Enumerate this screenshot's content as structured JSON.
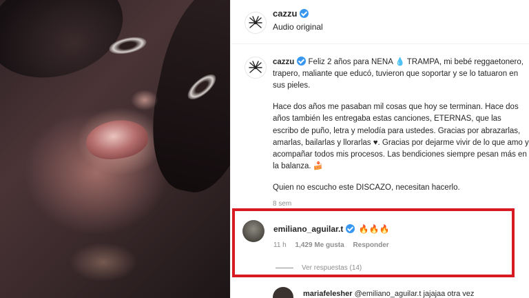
{
  "header": {
    "username": "cazzu",
    "subtitle": "Audio original"
  },
  "caption": {
    "username": "cazzu",
    "paragraphs": [
      "Feliz 2 años para NENA 💧 TRAMPA, mi bebé reggaetonero, trapero, maliante que educó, tuvieron que soportar y se lo tatuaron en sus pieles.",
      "Hace dos años me pasaban mil cosas que hoy se terminan. Hace dos años también les entregaba estas canciones, ETERNAS, que las escribo de puño, letra y melodía para ustedes. Gracias por abrazarlas, amarlas, bailarlas y llorarlas ♥. Gracias por dejarme vivir de lo que amo y acompañar todos mis procesos. Las bendiciones siempre pesan más en la balanza. 🍰",
      "Quien no escucho este DISCAZO, necesitan hacerlo."
    ],
    "time": "8 sem"
  },
  "comment": {
    "username": "emiliano_aguilar.t",
    "text": "🔥🔥🔥",
    "time": "11 h",
    "likes": "1,429 Me gusta",
    "reply": "Responder",
    "view_replies": "Ver respuestas (14)"
  },
  "next_comment": {
    "username": "mariafelesher",
    "text": "@emiliano_aguilar.t jajajaa otra vez"
  },
  "colors": {
    "highlight_border": "#d81b22",
    "verified": "#3897f0",
    "secondary_text": "#8e8e8e"
  }
}
